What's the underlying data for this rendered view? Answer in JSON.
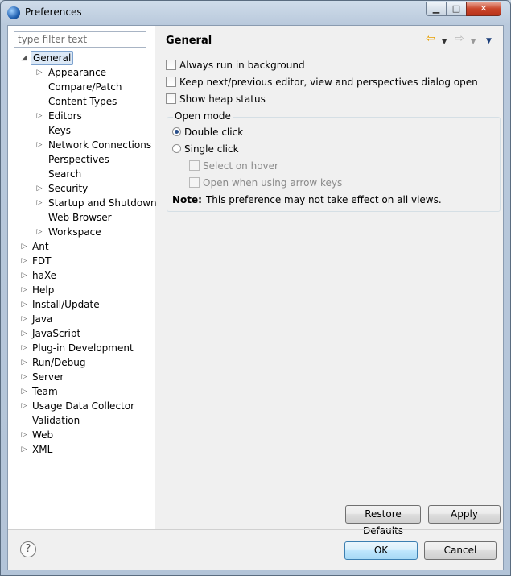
{
  "window": {
    "title": "Preferences",
    "app_icon": "eclipse-icon"
  },
  "title_buttons": {
    "minimize": "▁",
    "maximize": "□",
    "close": "✕"
  },
  "filter": {
    "placeholder": "type filter text",
    "value": ""
  },
  "tree": {
    "items": [
      {
        "label": "General",
        "expander": "expanded",
        "indent": 0,
        "selected": true
      },
      {
        "label": "Appearance",
        "expander": "collapsed",
        "indent": 1
      },
      {
        "label": "Compare/Patch",
        "expander": "none",
        "indent": 1
      },
      {
        "label": "Content Types",
        "expander": "none",
        "indent": 1
      },
      {
        "label": "Editors",
        "expander": "collapsed",
        "indent": 1
      },
      {
        "label": "Keys",
        "expander": "none",
        "indent": 1
      },
      {
        "label": "Network Connections",
        "expander": "collapsed",
        "indent": 1
      },
      {
        "label": "Perspectives",
        "expander": "none",
        "indent": 1
      },
      {
        "label": "Search",
        "expander": "none",
        "indent": 1
      },
      {
        "label": "Security",
        "expander": "collapsed",
        "indent": 1
      },
      {
        "label": "Startup and Shutdown",
        "expander": "collapsed",
        "indent": 1
      },
      {
        "label": "Web Browser",
        "expander": "none",
        "indent": 1
      },
      {
        "label": "Workspace",
        "expander": "collapsed",
        "indent": 1
      },
      {
        "label": "Ant",
        "expander": "collapsed",
        "indent": 0
      },
      {
        "label": "FDT",
        "expander": "collapsed",
        "indent": 0
      },
      {
        "label": "haXe",
        "expander": "collapsed",
        "indent": 0
      },
      {
        "label": "Help",
        "expander": "collapsed",
        "indent": 0
      },
      {
        "label": "Install/Update",
        "expander": "collapsed",
        "indent": 0
      },
      {
        "label": "Java",
        "expander": "collapsed",
        "indent": 0
      },
      {
        "label": "JavaScript",
        "expander": "collapsed",
        "indent": 0
      },
      {
        "label": "Plug-in Development",
        "expander": "collapsed",
        "indent": 0
      },
      {
        "label": "Run/Debug",
        "expander": "collapsed",
        "indent": 0
      },
      {
        "label": "Server",
        "expander": "collapsed",
        "indent": 0
      },
      {
        "label": "Team",
        "expander": "collapsed",
        "indent": 0
      },
      {
        "label": "Usage Data Collector",
        "expander": "collapsed",
        "indent": 0
      },
      {
        "label": "Validation",
        "expander": "none",
        "indent": 0
      },
      {
        "label": "Web",
        "expander": "collapsed",
        "indent": 0
      },
      {
        "label": "XML",
        "expander": "collapsed",
        "indent": 0
      }
    ]
  },
  "page": {
    "title": "General",
    "nav": {
      "back_icon": "back-arrow-icon",
      "forward_icon": "forward-arrow-icon",
      "menu_icon": "view-menu-icon"
    },
    "options": [
      {
        "label": "Always run in background",
        "checked": false
      },
      {
        "label": "Keep next/previous editor, view and perspectives dialog open",
        "checked": false
      },
      {
        "label": "Show heap status",
        "checked": false
      }
    ],
    "open_mode": {
      "title": "Open mode",
      "double_click": {
        "label": "Double click",
        "selected": true
      },
      "single_click": {
        "label": "Single click",
        "selected": false
      },
      "select_on_hover": {
        "label": "Select on hover",
        "checked": false,
        "enabled": false
      },
      "open_with_arrows": {
        "label": "Open when using arrow keys",
        "checked": false,
        "enabled": false
      },
      "note_label": "Note:",
      "note_text": "This preference may not take effect on all views."
    },
    "restore_defaults": "Restore Defaults",
    "apply": "Apply"
  },
  "footer": {
    "help_icon": "help-icon",
    "help_glyph": "?",
    "ok": "OK",
    "cancel": "Cancel"
  },
  "colors": {
    "selection_bg": "#dbe8f6",
    "selection_border": "#7da2ce",
    "back_arrow": "#e8a000"
  }
}
